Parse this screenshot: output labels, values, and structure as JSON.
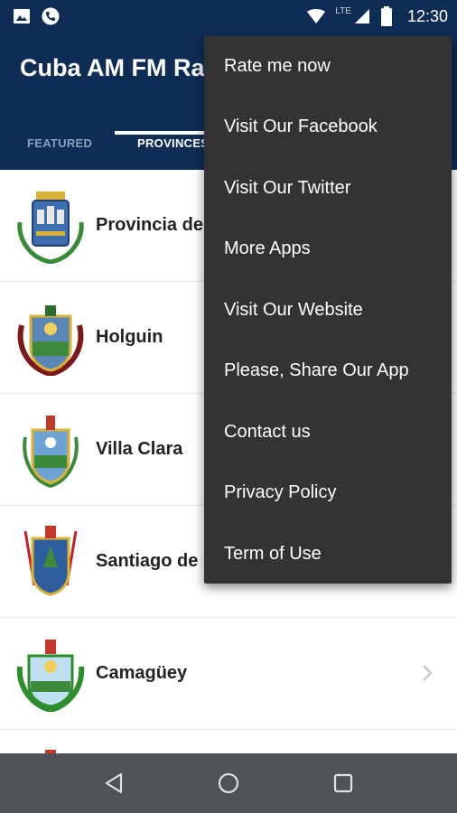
{
  "status_bar": {
    "time": "12:30",
    "network": "LTE",
    "icons": [
      "image-icon",
      "phone-call-icon",
      "wifi-icon",
      "signal-icon",
      "battery-icon"
    ]
  },
  "app_bar": {
    "title": "Cuba AM FM Ra",
    "tabs": [
      {
        "label": "FEATURED",
        "selected": false
      },
      {
        "label": "PROVINCES",
        "selected": true
      }
    ]
  },
  "provinces": [
    {
      "name": "Provincia de",
      "crest": "la-habana-crest-icon"
    },
    {
      "name": "Holguin",
      "crest": "holguin-crest-icon"
    },
    {
      "name": "Villa Clara",
      "crest": "villa-clara-crest-icon"
    },
    {
      "name": "Santiago de",
      "crest": "santiago-crest-icon"
    },
    {
      "name": "Camagüey",
      "crest": "camaguey-crest-icon"
    }
  ],
  "overflow_menu": {
    "items": [
      "Rate me now",
      "Visit Our Facebook",
      "Visit Our Twitter",
      "More Apps",
      "Visit Our Website",
      "Please, Share Our App",
      "Contact us",
      "Privacy Policy",
      "Term of Use"
    ]
  },
  "colors": {
    "app_bar": "#0f2c55",
    "menu_bg": "#333333",
    "nav_bar": "#4f5256"
  }
}
